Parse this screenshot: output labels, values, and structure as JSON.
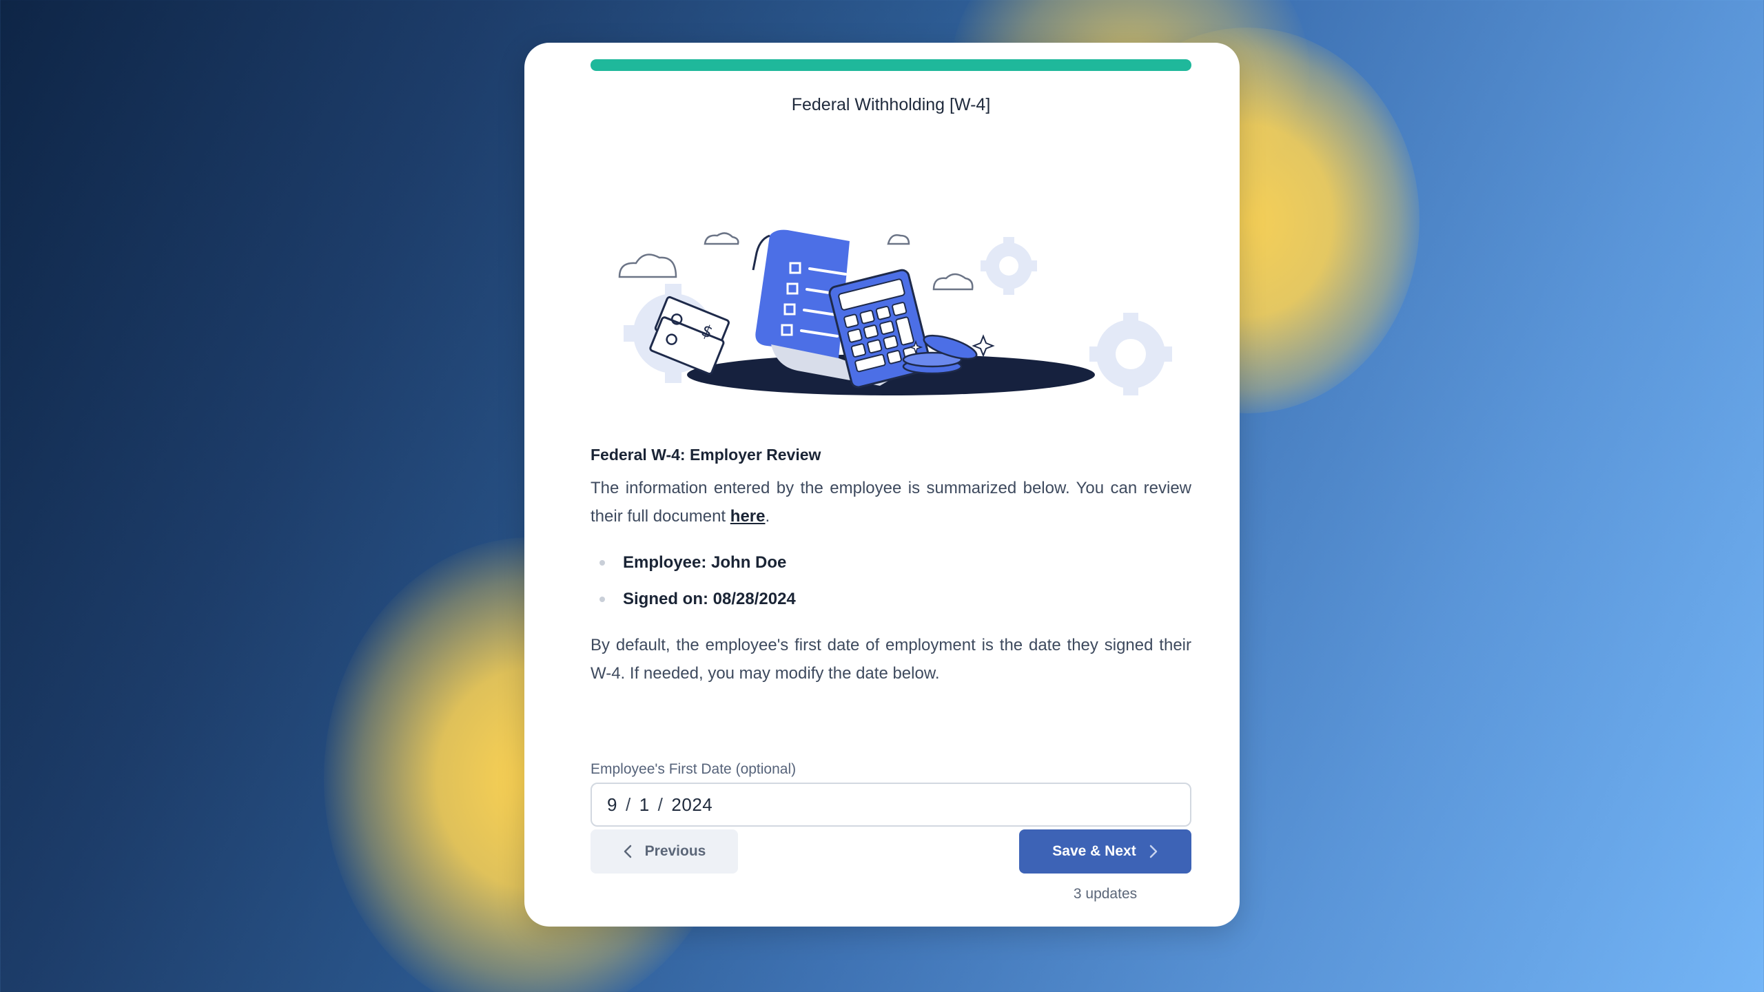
{
  "progress": {
    "fraction": 1.0,
    "color": "#1fb89b"
  },
  "step_title": "Federal Withholding [W-4]",
  "illustration": {
    "description_icon": "w4-tax-documents-illustration"
  },
  "review": {
    "heading": "Federal W-4: Employer Review",
    "intro_before_link": "The information entered by the employee is summarized below. You can review their full document ",
    "link_text": "here",
    "intro_after_link": ".",
    "bullets": [
      "Employee: John Doe",
      "Signed on: 08/28/2024"
    ],
    "note": "By default, the employee's first date of employment is the date they signed their W-4. If needed, you may modify the date below."
  },
  "first_date": {
    "label": "Employee's First Date (optional)",
    "month": "9",
    "day": "1",
    "year": "2024",
    "separator": "/"
  },
  "buttons": {
    "previous_label": "Previous",
    "next_label": "Save & Next",
    "next_color": "#3d63b6"
  },
  "updates_text": "3 updates"
}
